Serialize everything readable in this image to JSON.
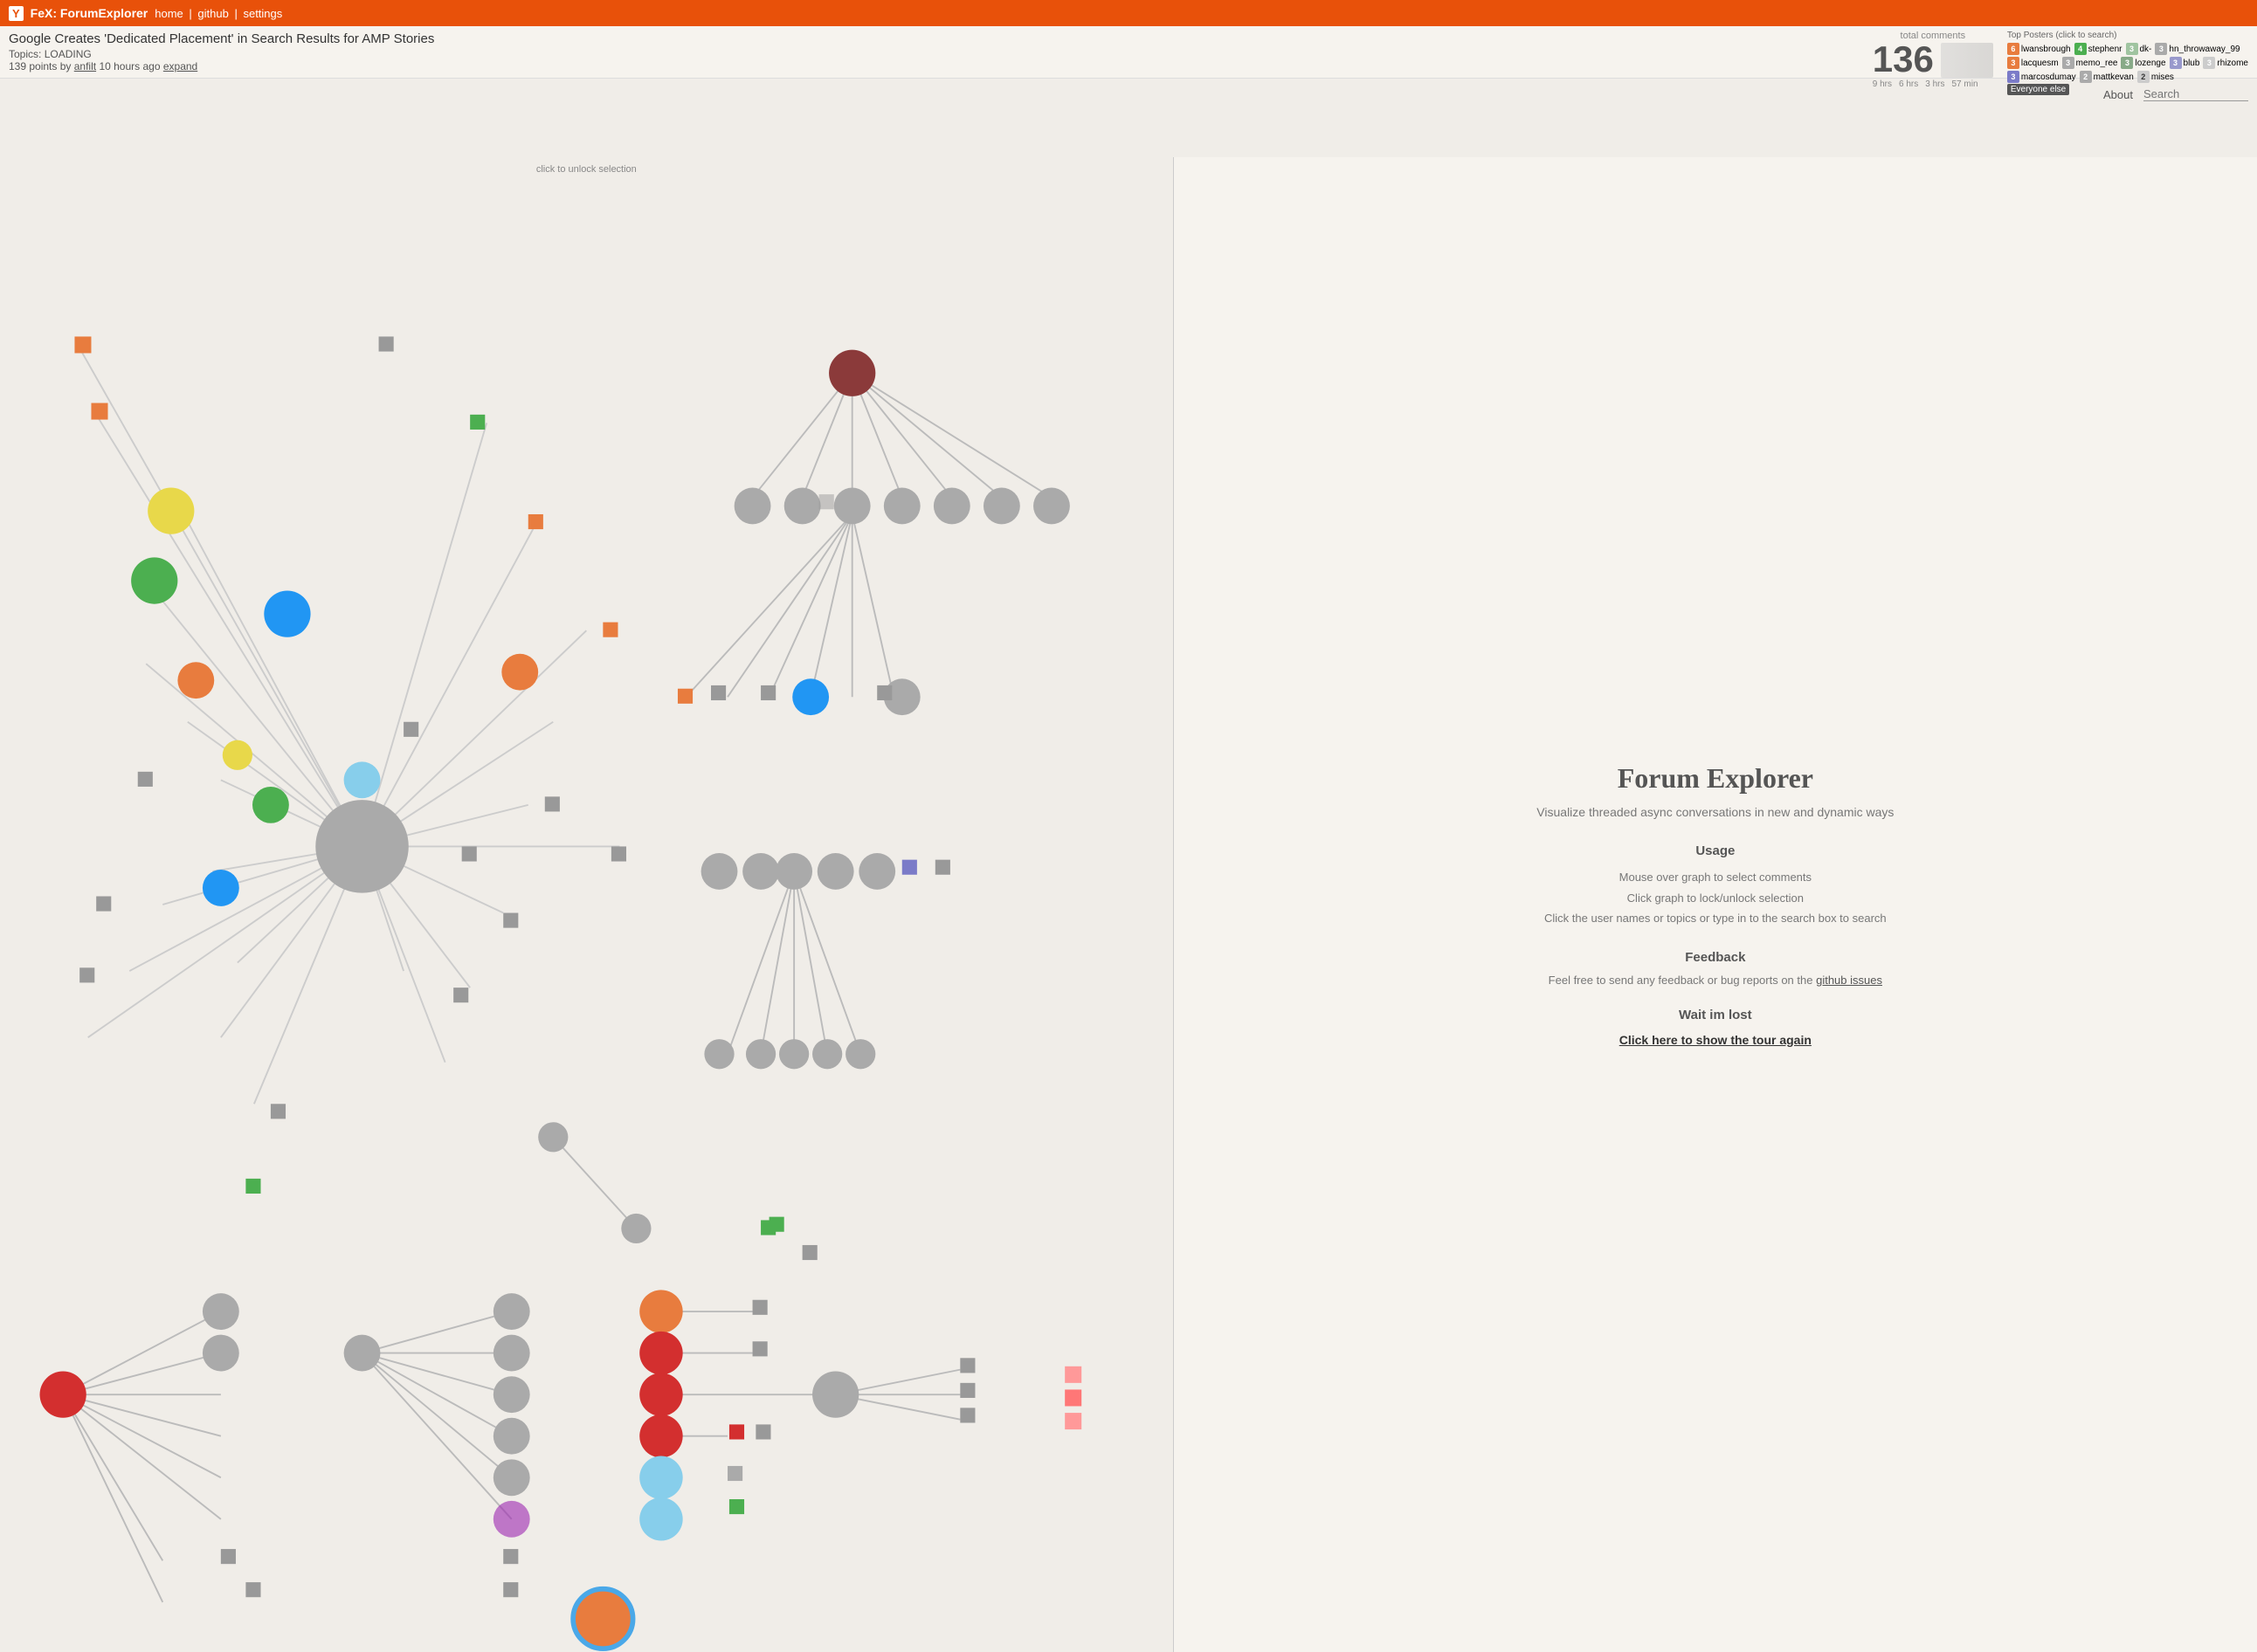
{
  "header": {
    "logo": "Y",
    "app_title": "FeX: ForumExplorer",
    "nav": {
      "home": "home",
      "github": "github",
      "settings": "settings"
    }
  },
  "article": {
    "title": "Google Creates 'Dedicated Placement' in Search Results for AMP Stories",
    "topics_label": "Topics:",
    "topics_value": "LOADING",
    "points": "139",
    "author": "anfilt",
    "time_ago": "10 hours ago",
    "expand_label": "expand"
  },
  "stats": {
    "total_comments_label": "total comments",
    "total_comments": "136",
    "timeline": [
      "9 hrs",
      "6 hrs",
      "3 hrs",
      "57 min"
    ]
  },
  "top_posters": {
    "title": "Top Posters (click to search)",
    "row1": [
      {
        "count": "6",
        "name": "lwansbrough",
        "color": "#e87c3e"
      },
      {
        "count": "4",
        "name": "stephenr",
        "color": "#4caf50"
      },
      {
        "count": "3",
        "name": "dk-",
        "color": "#a0c4a0"
      },
      {
        "count": "3",
        "name": "hn_throwaway_99",
        "color": "#aaa"
      }
    ],
    "row2": [
      {
        "count": "3",
        "name": "lacquesm",
        "color": "#e87c3e"
      },
      {
        "count": "3",
        "name": "memo_ree",
        "color": "#aaa"
      },
      {
        "count": "3",
        "name": "lozenge",
        "color": "#8b8"
      },
      {
        "count": "3",
        "name": "blub",
        "color": "#9999cc"
      },
      {
        "count": "3",
        "name": "rhizome",
        "color": "#ccc"
      }
    ],
    "row3": [
      {
        "count": "3",
        "name": "marcosdumay",
        "color": "#7b7bc8"
      },
      {
        "count": "2",
        "name": "mattkevan",
        "color": "#aaa"
      },
      {
        "count": "2",
        "name": "mises",
        "color": "#ccc"
      }
    ],
    "everyone_label": "Everyone else"
  },
  "about_search": {
    "about_label": "About",
    "search_placeholder": "Search"
  },
  "graph": {
    "unlock_hint": "click to unlock selection"
  },
  "right_panel": {
    "title": "Forum Explorer",
    "subtitle": "Visualize threaded async conversations in new and dynamic ways",
    "usage_heading": "Usage",
    "usage_lines": [
      "Mouse over graph to select comments",
      "Click graph to lock/unlock selection",
      "Click the user names or topics or type in to the search box to search"
    ],
    "feedback_heading": "Feedback",
    "feedback_text": "Feel free to send any feedback or bug reports on the",
    "feedback_link_text": "github issues",
    "wait_heading": "Wait im lost",
    "tour_link": "Click here to show the tour again"
  }
}
